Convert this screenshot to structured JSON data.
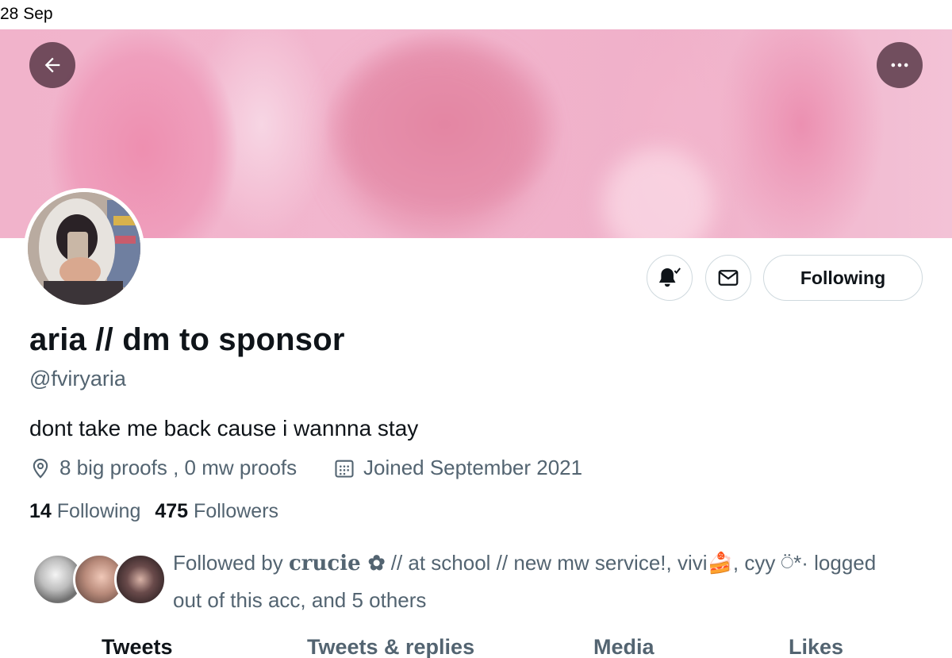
{
  "status_bar": {
    "date": "28 Sep"
  },
  "header": {
    "back_icon": "arrow-left-icon",
    "more_icon": "more-dots-icon"
  },
  "profile": {
    "display_name": "aria // dm to sponsor",
    "handle": "@fviryaria",
    "bio": "dont take me back cause i wannna stay",
    "location": "8 big proofs , 0 mw proofs",
    "joined": "Joined September 2021",
    "following_count": "14",
    "following_label": "Following",
    "followers_count": "475",
    "followers_label": "Followers"
  },
  "actions": {
    "notifications_icon": "bell-check-icon",
    "message_icon": "mail-icon",
    "following_button": "Following"
  },
  "followed_by": {
    "prefix": "Followed by ",
    "name1": "crucie ✿",
    "rest_line1": " // at school // new mw service!, vivi🍰, cyy ⍥*· logged",
    "rest_line2": "out of this acc, and 5 others"
  },
  "tabs": [
    {
      "label": "Tweets",
      "active": true
    },
    {
      "label": "Tweets & replies",
      "active": false
    },
    {
      "label": "Media",
      "active": false
    },
    {
      "label": "Likes",
      "active": false
    }
  ],
  "colors": {
    "text_primary": "#0f1419",
    "text_secondary": "#536471",
    "border": "#cfd9de",
    "banner_pink": "#f0b0c9"
  }
}
